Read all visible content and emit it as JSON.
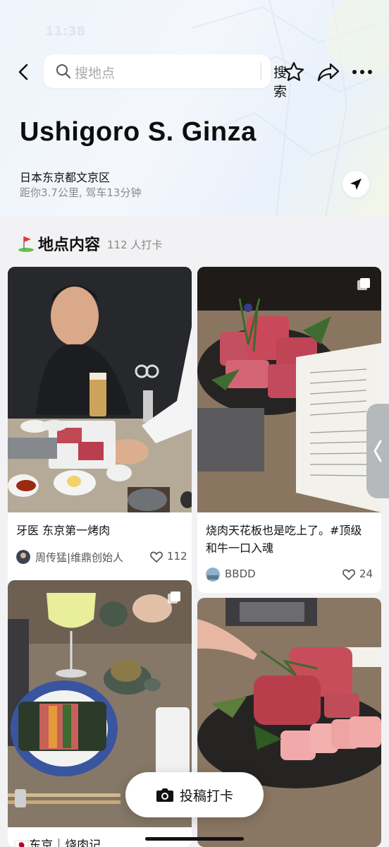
{
  "status_bar": {
    "time": "11:38"
  },
  "search": {
    "placeholder": "搜地点",
    "button_label": "搜索"
  },
  "place": {
    "title": "Ushigoro S. Ginza",
    "address": "日本东京都文京区",
    "distance": "距你3.7公里, 驾车13分钟"
  },
  "section": {
    "title": "地点内容",
    "count": "112 人打卡"
  },
  "posts": [
    {
      "title": "牙医 东京第一烤肉",
      "author": "周传猛|维鼎创始人",
      "likes": "112",
      "multi_image": false
    },
    {
      "title": "烧肉天花板也是吃上了。#顶级和牛一口入魂",
      "author": "BBDD",
      "likes": "24",
      "multi_image": true
    },
    {
      "title": "🇯🇵东京｜烧肉记",
      "multi_image": true
    },
    {
      "title": "",
      "multi_image": false
    }
  ],
  "post_button": {
    "label": "投稿打卡"
  },
  "colors": {
    "accent": "#111111",
    "hero_bg": "#eef4fb",
    "page_bg": "#f2f2f4"
  }
}
